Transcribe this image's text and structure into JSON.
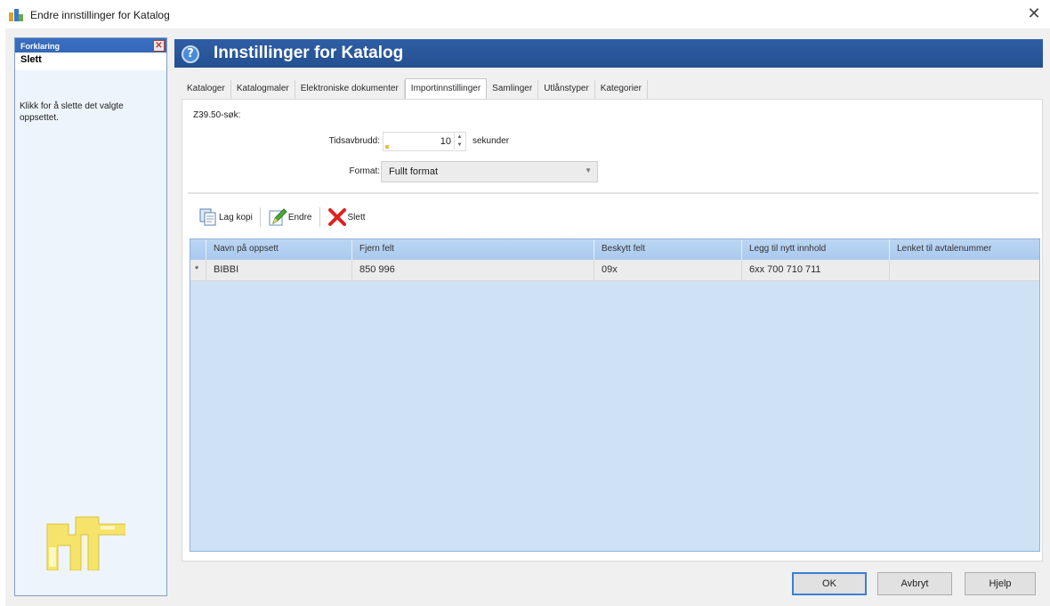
{
  "window": {
    "title": "Endre innstillinger for Katalog",
    "close_glyph": "✕"
  },
  "help_panel": {
    "header_title": "Forklaring",
    "header_subtitle": "Slett",
    "close_glyph": "✕",
    "text": "Klikk for å slette det valgte oppsettet."
  },
  "header": {
    "icon_glyph": "?",
    "title": "Innstillinger for Katalog"
  },
  "tabs": [
    {
      "label": "Kataloger",
      "active": false
    },
    {
      "label": "Katalogmaler",
      "active": false
    },
    {
      "label": "Elektroniske dokumenter",
      "active": false
    },
    {
      "label": "Importinnstillinger",
      "active": true
    },
    {
      "label": "Samlinger",
      "active": false
    },
    {
      "label": "Utlånstyper",
      "active": false
    },
    {
      "label": "Kategorier",
      "active": false
    }
  ],
  "z3950": {
    "section_label": "Z39.50-søk:",
    "timeout_label": "Tidsavbrudd:",
    "timeout_value": "10",
    "timeout_unit": "sekunder",
    "format_label": "Format:",
    "format_value": "Fullt format"
  },
  "toolbar": {
    "copy_label": "Lag kopi",
    "edit_label": "Endre",
    "delete_label": "Slett"
  },
  "grid": {
    "columns": [
      "Navn på oppsett",
      "Fjern felt",
      "Beskytt felt",
      "Legg til nytt innhold",
      "Lenket til avtalenummer"
    ],
    "rows": [
      {
        "marker": "*",
        "cells": [
          "BIBBI",
          "850 996",
          "09x",
          "6xx 700 710 711",
          ""
        ]
      }
    ]
  },
  "buttons": {
    "ok": "OK",
    "cancel": "Avbryt",
    "help": "Hjelp"
  },
  "colors": {
    "header_blue": "#2f5ea6",
    "grid_header": "#bcd6f3",
    "grid_body": "#cfe2f5",
    "delete_red": "#e02020"
  }
}
